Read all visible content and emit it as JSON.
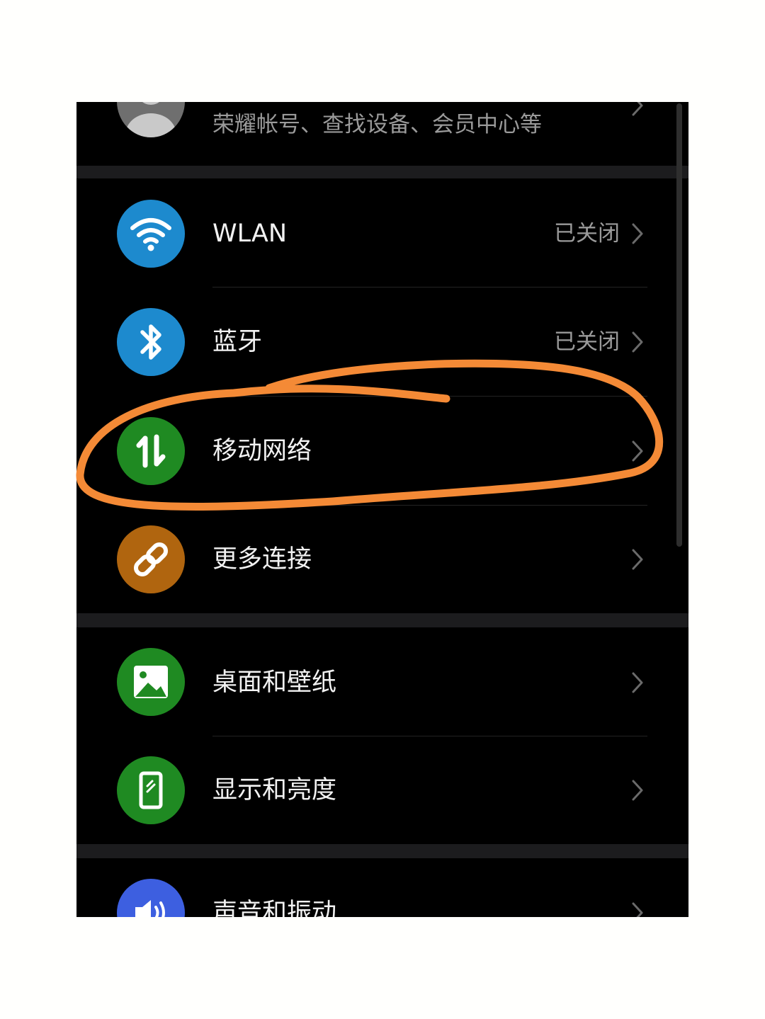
{
  "account": {
    "subtitle": "荣耀帐号、查找设备、会员中心等",
    "avatar_icon": "person-avatar-icon"
  },
  "settings": [
    {
      "label": "WLAN",
      "value": "已关闭",
      "icon": "wifi-icon",
      "color": "#1d8ace"
    },
    {
      "label": "蓝牙",
      "value": "已关闭",
      "icon": "bluetooth-icon",
      "color": "#1d8ace"
    },
    {
      "label": "移动网络",
      "value": "",
      "icon": "mobile-data-icon",
      "color": "#1f8a22"
    },
    {
      "label": "更多连接",
      "value": "",
      "icon": "link-icon",
      "color": "#b0650f"
    },
    {
      "label": "桌面和壁纸",
      "value": "",
      "icon": "wallpaper-icon",
      "color": "#1f8a22"
    },
    {
      "label": "显示和亮度",
      "value": "",
      "icon": "display-icon",
      "color": "#1f8a22"
    },
    {
      "label": "声音和振动",
      "value": "",
      "icon": "sound-icon",
      "color": "#3d5fe0"
    }
  ],
  "annotation": {
    "color": "#f48a36",
    "highlighted_item": "移动网络"
  }
}
